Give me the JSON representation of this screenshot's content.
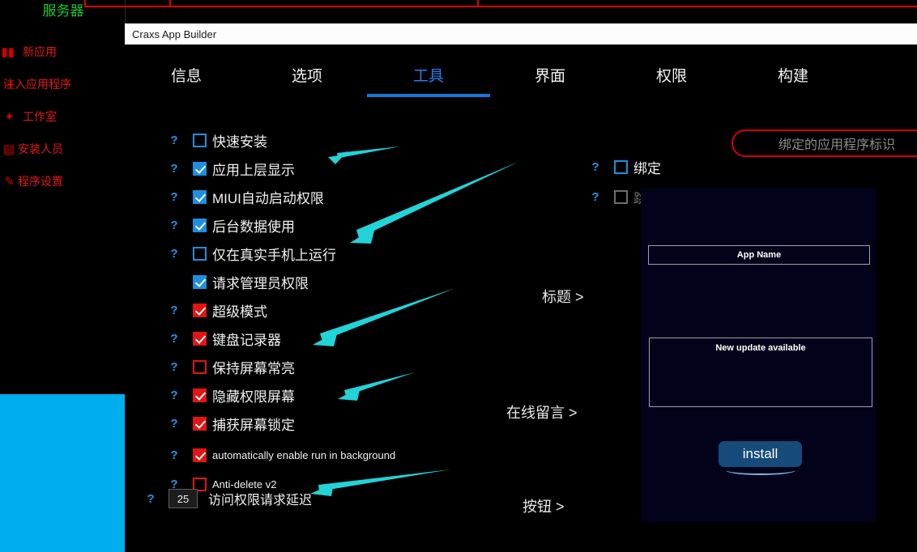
{
  "desktop": {
    "server_label": "服务器",
    "sidebar_items": [
      {
        "icon": "chart-icon",
        "label": "新应用"
      },
      {
        "icon": "inject-icon",
        "label": "注入应用程序"
      },
      {
        "icon": "workshop-icon",
        "label": "工作室"
      },
      {
        "icon": "installer-icon",
        "label": "安装人员"
      },
      {
        "icon": "settings-icon",
        "label": "程序设置"
      }
    ]
  },
  "window": {
    "title": "Craxs App Builder"
  },
  "tabs": [
    {
      "label": "信息",
      "active": false
    },
    {
      "label": "选项",
      "active": false
    },
    {
      "label": "工具",
      "active": true
    },
    {
      "label": "界面",
      "active": false
    },
    {
      "label": "权限",
      "active": false
    },
    {
      "label": "构建",
      "active": false
    }
  ],
  "options_left": [
    {
      "label": "快速安装",
      "checked": false,
      "color": "blue",
      "help": true,
      "small": false
    },
    {
      "label": "应用上层显示",
      "checked": true,
      "color": "blue",
      "help": true,
      "small": false
    },
    {
      "label": "MIUI自动启动权限",
      "checked": true,
      "color": "blue",
      "help": true,
      "small": false
    },
    {
      "label": "后台数据使用",
      "checked": true,
      "color": "blue",
      "help": true,
      "small": false
    },
    {
      "label": "仅在真实手机上运行",
      "checked": false,
      "color": "blue",
      "help": true,
      "small": false
    },
    {
      "label": "请求管理员权限",
      "checked": true,
      "color": "blue",
      "help": false,
      "small": false
    },
    {
      "label": "超级模式",
      "checked": true,
      "color": "red",
      "help": true,
      "small": false
    },
    {
      "label": "键盘记录器",
      "checked": true,
      "color": "red",
      "help": true,
      "small": false
    },
    {
      "label": "保持屏幕常亮",
      "checked": false,
      "color": "red",
      "help": true,
      "small": false
    },
    {
      "label": "隐藏权限屏幕",
      "checked": true,
      "color": "red",
      "help": true,
      "small": false
    },
    {
      "label": "捕获屏幕锁定",
      "checked": true,
      "color": "red",
      "help": true,
      "small": false
    },
    {
      "label": "automatically enable run in background",
      "checked": true,
      "color": "red",
      "help": true,
      "small": true
    },
    {
      "label": "Anti-delete v2",
      "checked": false,
      "color": "red",
      "help": true,
      "small": true
    }
  ],
  "options_right": [
    {
      "label": "绑定",
      "checked": false,
      "color": "blue",
      "help": true,
      "disabled": false
    },
    {
      "label": "跳过重新安装",
      "checked": false,
      "color": "gray",
      "help": true,
      "disabled": true
    }
  ],
  "binding_field": {
    "placeholder": "绑定的应用程序标识",
    "value": ""
  },
  "delay": {
    "value": "25",
    "label": "访问权限请求延迟"
  },
  "section_links": [
    {
      "label": "标题 >"
    },
    {
      "label": "在线留言 >"
    },
    {
      "label": "按钮 >"
    }
  ],
  "preview": {
    "app_name": "App Name",
    "message": "New update available",
    "install_label": "install"
  },
  "colors": {
    "accent_blue": "#1e8fe0",
    "accent_red": "#e21414",
    "arrow_cyan": "#22d3d8",
    "sidebar_red": "#e01b1b",
    "sidebar_green": "#14cc33",
    "cyan_block": "#00aeef"
  }
}
